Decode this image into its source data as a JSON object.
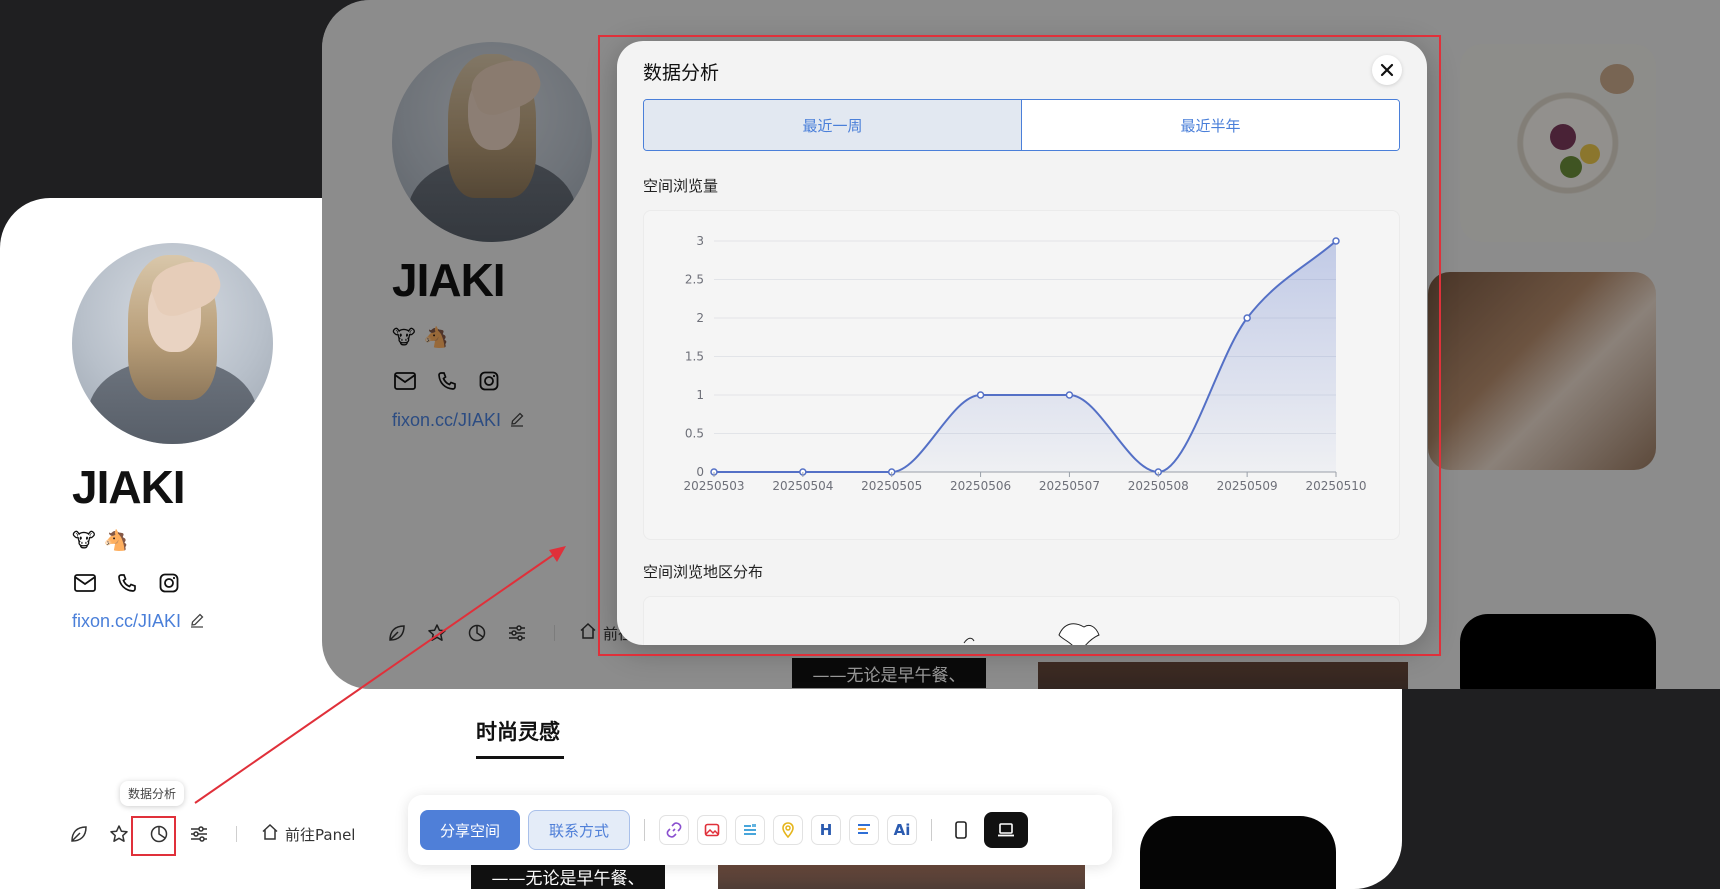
{
  "profile": {
    "name": "JIAKI",
    "emojis": [
      "🐮",
      "🐴"
    ],
    "link": "fixon.cc/JIAKI",
    "panel_link": "前往Panel"
  },
  "toolbar": {
    "tooltip": "数据分析"
  },
  "section": {
    "title": "时尚灵感"
  },
  "bottom_bar": {
    "share_label": "分享空间",
    "contact_label": "联系方式",
    "heading_icon": "H",
    "ai_icon": "Ai"
  },
  "captions": {
    "front_caption": "——无论是早午餐、",
    "back_caption": "——无论是早午餐、"
  },
  "modal": {
    "title": "数据分析",
    "tabs": [
      "最近一周",
      "最近半年"
    ],
    "active_tab": 0,
    "chart1_label": "空间浏览量",
    "chart2_label": "空间浏览地区分布"
  },
  "colors": {
    "accent": "#4a7fd9",
    "annotation": "#e0303a",
    "line": "#5470c6"
  },
  "icons": {
    "front_tools": [
      "leaf-icon",
      "star-icon",
      "pie-chart-icon",
      "sliders-icon",
      "home-icon"
    ],
    "contacts": [
      "mail-icon",
      "phone-icon",
      "instagram-icon"
    ],
    "bottom_bar": [
      "link-icon",
      "image-icon",
      "text-icon",
      "location-icon",
      "heading-icon",
      "align-icon",
      "ai-icon",
      "mobile-icon",
      "laptop-icon"
    ]
  },
  "chart_data": {
    "type": "area",
    "title": "空间浏览量",
    "x": [
      "20250503",
      "20250504",
      "20250505",
      "20250506",
      "20250507",
      "20250508",
      "20250509",
      "20250510"
    ],
    "series": [
      {
        "values": [
          0,
          0,
          0,
          1,
          1,
          0,
          2,
          3
        ]
      }
    ],
    "yticks": [
      0,
      0.5,
      1,
      1.5,
      2,
      2.5,
      3
    ],
    "ylim": [
      0,
      3
    ],
    "grid": true,
    "smooth": true
  }
}
